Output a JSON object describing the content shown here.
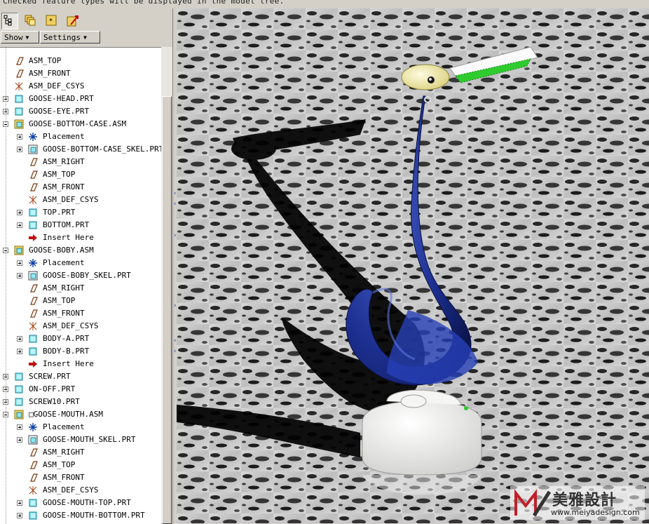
{
  "status_text": "Checked feature types will be displayed in the model tree.",
  "toolbar": {
    "icons": [
      "model-tree-icon",
      "layers-icon",
      "settings-icon",
      "show-icon"
    ]
  },
  "menus": {
    "show_label": "Show",
    "settings_label": "Settings"
  },
  "tree": {
    "items": [
      {
        "label": "ASM_TOP",
        "icon": "datum-plane-icon",
        "depth": 1,
        "expander": "none"
      },
      {
        "label": "ASM_FRONT",
        "icon": "datum-plane-icon",
        "depth": 1,
        "expander": "none"
      },
      {
        "label": "ASM_DEF_CSYS",
        "icon": "csys-icon",
        "depth": 1,
        "expander": "none"
      },
      {
        "label": "GOOSE-HEAD.PRT",
        "icon": "part-icon",
        "depth": 1,
        "expander": "plus"
      },
      {
        "label": "GOOSE-EYE.PRT",
        "icon": "part-icon",
        "depth": 1,
        "expander": "plus"
      },
      {
        "label": "GOOSE-BOTTOM-CASE.ASM",
        "icon": "assembly-icon",
        "depth": 1,
        "expander": "minus"
      },
      {
        "label": "Placement",
        "icon": "placement-icon",
        "depth": 2,
        "expander": "plus"
      },
      {
        "label": "GOOSE-BOTTOM-CASE_SKEL.PRT",
        "icon": "skeleton-icon",
        "depth": 2,
        "expander": "plus"
      },
      {
        "label": "ASM_RIGHT",
        "icon": "datum-plane-icon",
        "depth": 2,
        "expander": "none"
      },
      {
        "label": "ASM_TOP",
        "icon": "datum-plane-icon",
        "depth": 2,
        "expander": "none"
      },
      {
        "label": "ASM_FRONT",
        "icon": "datum-plane-icon",
        "depth": 2,
        "expander": "none"
      },
      {
        "label": "ASM_DEF_CSYS",
        "icon": "csys-icon",
        "depth": 2,
        "expander": "none"
      },
      {
        "label": "TOP.PRT",
        "icon": "part-icon",
        "depth": 2,
        "expander": "plus"
      },
      {
        "label": "BOTTOM.PRT",
        "icon": "part-icon",
        "depth": 2,
        "expander": "plus"
      },
      {
        "label": "Insert Here",
        "icon": "insert-arrow-icon",
        "depth": 2,
        "expander": "none"
      },
      {
        "label": "GOOSE-BOBY.ASM",
        "icon": "assembly-icon",
        "depth": 1,
        "expander": "minus"
      },
      {
        "label": "Placement",
        "icon": "placement-icon",
        "depth": 2,
        "expander": "plus"
      },
      {
        "label": "GOOSE-BOBY_SKEL.PRT",
        "icon": "skeleton-icon",
        "depth": 2,
        "expander": "plus"
      },
      {
        "label": "ASM_RIGHT",
        "icon": "datum-plane-icon",
        "depth": 2,
        "expander": "none"
      },
      {
        "label": "ASM_TOP",
        "icon": "datum-plane-icon",
        "depth": 2,
        "expander": "none"
      },
      {
        "label": "ASM_FRONT",
        "icon": "datum-plane-icon",
        "depth": 2,
        "expander": "none"
      },
      {
        "label": "ASM_DEF_CSYS",
        "icon": "csys-icon",
        "depth": 2,
        "expander": "none"
      },
      {
        "label": "BODY-A.PRT",
        "icon": "part-icon",
        "depth": 2,
        "expander": "plus"
      },
      {
        "label": "BODY-B.PRT",
        "icon": "part-icon",
        "depth": 2,
        "expander": "plus"
      },
      {
        "label": "Insert Here",
        "icon": "insert-arrow-icon",
        "depth": 2,
        "expander": "none"
      },
      {
        "label": "SCREW.PRT",
        "icon": "part-icon",
        "depth": 1,
        "expander": "plus"
      },
      {
        "label": "ON-OFF.PRT",
        "icon": "part-icon",
        "depth": 1,
        "expander": "plus"
      },
      {
        "label": "SCREW10.PRT",
        "icon": "part-icon",
        "depth": 1,
        "expander": "plus"
      },
      {
        "label": "□GOOSE-MOUTH.ASM",
        "icon": "assembly-icon",
        "depth": 1,
        "expander": "minus"
      },
      {
        "label": "Placement",
        "icon": "placement-icon",
        "depth": 2,
        "expander": "plus"
      },
      {
        "label": "GOOSE-MOUTH_SKEL.PRT",
        "icon": "skeleton-icon",
        "depth": 2,
        "expander": "plus"
      },
      {
        "label": "ASM_RIGHT",
        "icon": "datum-plane-icon",
        "depth": 2,
        "expander": "none"
      },
      {
        "label": "ASM_TOP",
        "icon": "datum-plane-icon",
        "depth": 2,
        "expander": "none"
      },
      {
        "label": "ASM_FRONT",
        "icon": "datum-plane-icon",
        "depth": 2,
        "expander": "none"
      },
      {
        "label": "ASM_DEF_CSYS",
        "icon": "csys-icon",
        "depth": 2,
        "expander": "none"
      },
      {
        "label": "GOOSE-MOUTH-TOP.PRT",
        "icon": "part-icon",
        "depth": 2,
        "expander": "plus"
      },
      {
        "label": "GOOSE-MOUTH-BOTTOM.PRT",
        "icon": "part-icon",
        "depth": 2,
        "expander": "plus"
      }
    ]
  },
  "watermark": {
    "title": "美雅設計",
    "url": "www.meiyadesign.com"
  },
  "colors": {
    "goose_body": "#1c2f8f",
    "beak": "#f3eeb4",
    "base": "#f2f2ee",
    "mouth_green": "#2ecc2e",
    "insert_arrow": "#c01010"
  }
}
